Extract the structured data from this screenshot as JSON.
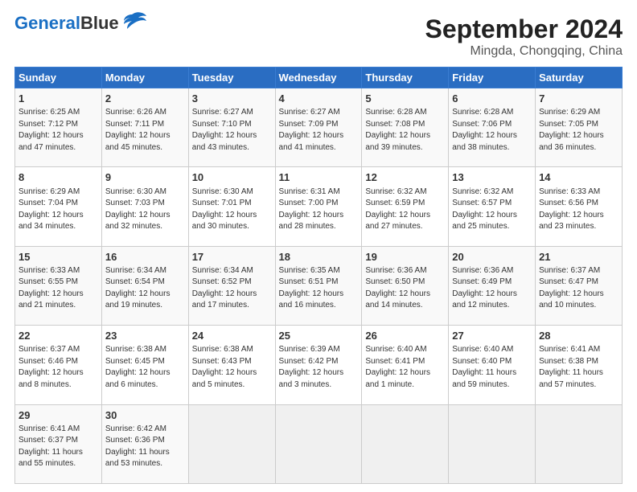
{
  "header": {
    "logo_line1": "General",
    "logo_line2": "Blue",
    "title": "September 2024",
    "subtitle": "Mingda, Chongqing, China"
  },
  "days_of_week": [
    "Sunday",
    "Monday",
    "Tuesday",
    "Wednesday",
    "Thursday",
    "Friday",
    "Saturday"
  ],
  "weeks": [
    [
      {
        "day": "1",
        "info": "Sunrise: 6:25 AM\nSunset: 7:12 PM\nDaylight: 12 hours\nand 47 minutes."
      },
      {
        "day": "2",
        "info": "Sunrise: 6:26 AM\nSunset: 7:11 PM\nDaylight: 12 hours\nand 45 minutes."
      },
      {
        "day": "3",
        "info": "Sunrise: 6:27 AM\nSunset: 7:10 PM\nDaylight: 12 hours\nand 43 minutes."
      },
      {
        "day": "4",
        "info": "Sunrise: 6:27 AM\nSunset: 7:09 PM\nDaylight: 12 hours\nand 41 minutes."
      },
      {
        "day": "5",
        "info": "Sunrise: 6:28 AM\nSunset: 7:08 PM\nDaylight: 12 hours\nand 39 minutes."
      },
      {
        "day": "6",
        "info": "Sunrise: 6:28 AM\nSunset: 7:06 PM\nDaylight: 12 hours\nand 38 minutes."
      },
      {
        "day": "7",
        "info": "Sunrise: 6:29 AM\nSunset: 7:05 PM\nDaylight: 12 hours\nand 36 minutes."
      }
    ],
    [
      {
        "day": "8",
        "info": "Sunrise: 6:29 AM\nSunset: 7:04 PM\nDaylight: 12 hours\nand 34 minutes."
      },
      {
        "day": "9",
        "info": "Sunrise: 6:30 AM\nSunset: 7:03 PM\nDaylight: 12 hours\nand 32 minutes."
      },
      {
        "day": "10",
        "info": "Sunrise: 6:30 AM\nSunset: 7:01 PM\nDaylight: 12 hours\nand 30 minutes."
      },
      {
        "day": "11",
        "info": "Sunrise: 6:31 AM\nSunset: 7:00 PM\nDaylight: 12 hours\nand 28 minutes."
      },
      {
        "day": "12",
        "info": "Sunrise: 6:32 AM\nSunset: 6:59 PM\nDaylight: 12 hours\nand 27 minutes."
      },
      {
        "day": "13",
        "info": "Sunrise: 6:32 AM\nSunset: 6:57 PM\nDaylight: 12 hours\nand 25 minutes."
      },
      {
        "day": "14",
        "info": "Sunrise: 6:33 AM\nSunset: 6:56 PM\nDaylight: 12 hours\nand 23 minutes."
      }
    ],
    [
      {
        "day": "15",
        "info": "Sunrise: 6:33 AM\nSunset: 6:55 PM\nDaylight: 12 hours\nand 21 minutes."
      },
      {
        "day": "16",
        "info": "Sunrise: 6:34 AM\nSunset: 6:54 PM\nDaylight: 12 hours\nand 19 minutes."
      },
      {
        "day": "17",
        "info": "Sunrise: 6:34 AM\nSunset: 6:52 PM\nDaylight: 12 hours\nand 17 minutes."
      },
      {
        "day": "18",
        "info": "Sunrise: 6:35 AM\nSunset: 6:51 PM\nDaylight: 12 hours\nand 16 minutes."
      },
      {
        "day": "19",
        "info": "Sunrise: 6:36 AM\nSunset: 6:50 PM\nDaylight: 12 hours\nand 14 minutes."
      },
      {
        "day": "20",
        "info": "Sunrise: 6:36 AM\nSunset: 6:49 PM\nDaylight: 12 hours\nand 12 minutes."
      },
      {
        "day": "21",
        "info": "Sunrise: 6:37 AM\nSunset: 6:47 PM\nDaylight: 12 hours\nand 10 minutes."
      }
    ],
    [
      {
        "day": "22",
        "info": "Sunrise: 6:37 AM\nSunset: 6:46 PM\nDaylight: 12 hours\nand 8 minutes."
      },
      {
        "day": "23",
        "info": "Sunrise: 6:38 AM\nSunset: 6:45 PM\nDaylight: 12 hours\nand 6 minutes."
      },
      {
        "day": "24",
        "info": "Sunrise: 6:38 AM\nSunset: 6:43 PM\nDaylight: 12 hours\nand 5 minutes."
      },
      {
        "day": "25",
        "info": "Sunrise: 6:39 AM\nSunset: 6:42 PM\nDaylight: 12 hours\nand 3 minutes."
      },
      {
        "day": "26",
        "info": "Sunrise: 6:40 AM\nSunset: 6:41 PM\nDaylight: 12 hours\nand 1 minute."
      },
      {
        "day": "27",
        "info": "Sunrise: 6:40 AM\nSunset: 6:40 PM\nDaylight: 11 hours\nand 59 minutes."
      },
      {
        "day": "28",
        "info": "Sunrise: 6:41 AM\nSunset: 6:38 PM\nDaylight: 11 hours\nand 57 minutes."
      }
    ],
    [
      {
        "day": "29",
        "info": "Sunrise: 6:41 AM\nSunset: 6:37 PM\nDaylight: 11 hours\nand 55 minutes."
      },
      {
        "day": "30",
        "info": "Sunrise: 6:42 AM\nSunset: 6:36 PM\nDaylight: 11 hours\nand 53 minutes."
      },
      {
        "day": "",
        "info": ""
      },
      {
        "day": "",
        "info": ""
      },
      {
        "day": "",
        "info": ""
      },
      {
        "day": "",
        "info": ""
      },
      {
        "day": "",
        "info": ""
      }
    ]
  ]
}
